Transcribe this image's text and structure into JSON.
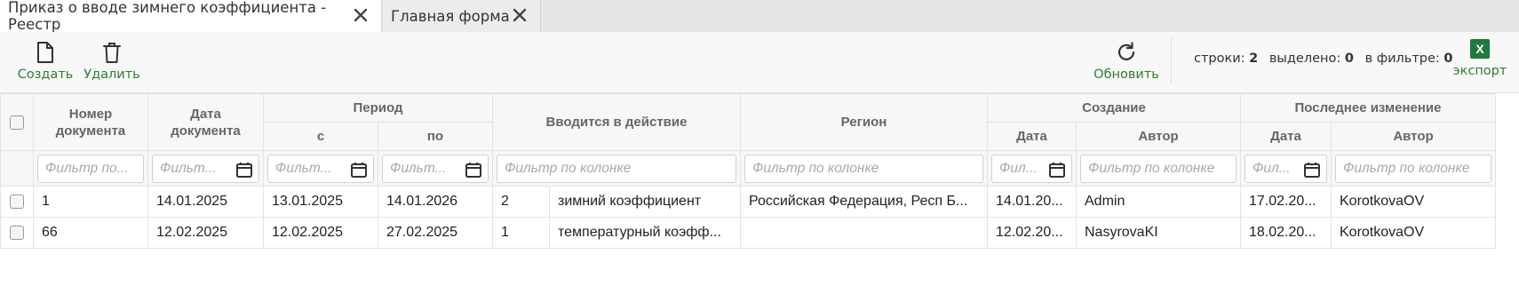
{
  "tabs": [
    {
      "label": "Приказ о вводе зимнего коэффициента - Реестр"
    },
    {
      "label": "Главная форма"
    }
  ],
  "toolbar": {
    "create_label": "Создать",
    "delete_label": "Удалить",
    "refresh_label": "Обновить",
    "export_label": "экспорт",
    "excel_badge": "X",
    "rows_label": "строки:",
    "rows_value": "2",
    "selected_label": "выделено:",
    "selected_value": "0",
    "filter_label": "в фильтре:",
    "filter_value": "0",
    "accent_color": "#2e7d32"
  },
  "grid": {
    "headers": {
      "doc_number": "Номер документа",
      "doc_date": "Дата документа",
      "period": "Период",
      "period_from": "с",
      "period_to": "по",
      "effective": "Вводится в действие",
      "region": "Регион",
      "created": "Создание",
      "created_date": "Дата",
      "created_author": "Автор",
      "modified": "Последнее изменение",
      "modified_date": "Дата",
      "modified_author": "Автор"
    },
    "filters": {
      "f1": "Фильтр по...",
      "f2": "Фильт...",
      "f3": "Фильт...",
      "f4": "Фильт...",
      "f5": "Фильтр по колонке",
      "f6": "Фильтр по колонке",
      "f7": "Фил...",
      "f8": "Фильтр по колонке",
      "f9": "Фил...",
      "f10": "Фильтр по колонке"
    },
    "rows": [
      {
        "number": "1",
        "date": "14.01.2025",
        "from": "13.01.2025",
        "to": "14.01.2026",
        "code": "2",
        "type": "зимний коэффициент",
        "region": "Российская Федерация, Респ Б...",
        "c_date": "14.01.20...",
        "c_author": "Admin",
        "m_date": "17.02.20...",
        "m_author": "KorotkovaOV"
      },
      {
        "number": "66",
        "date": "12.02.2025",
        "from": "12.02.2025",
        "to": "27.02.2025",
        "code": "1",
        "type": "температурный коэфф...",
        "region": "",
        "c_date": "12.02.20...",
        "c_author": "NasyrovaKI",
        "m_date": "18.02.20...",
        "m_author": "KorotkovaOV"
      }
    ]
  }
}
